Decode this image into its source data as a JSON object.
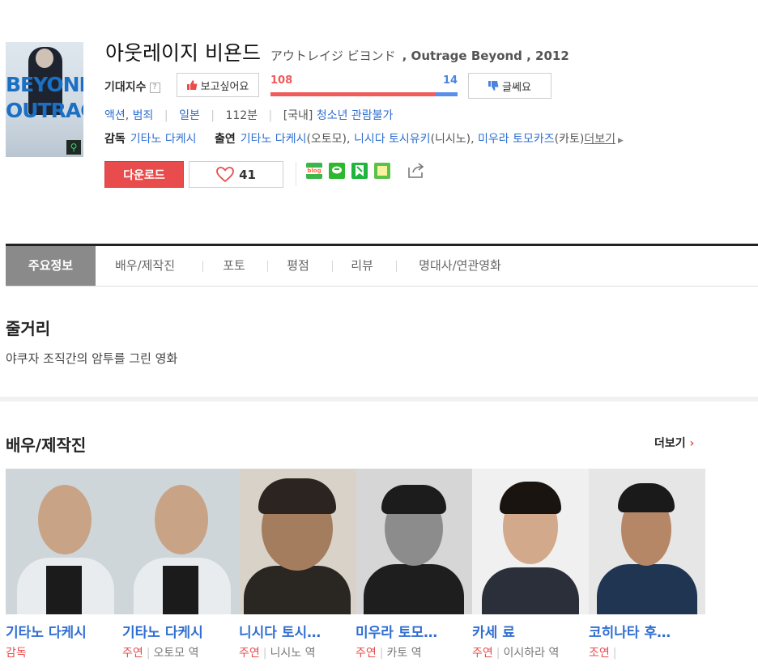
{
  "movie": {
    "title": "아웃레이지 비욘드",
    "title_jp": "アウトレイジ ビヨンド",
    "title_rest": ", Outrage Beyond , 2012",
    "poster_text_top": "BEYOND",
    "poster_text_bottom": "OUTRAGE"
  },
  "expectation": {
    "label": "기대지수",
    "help": "?",
    "want_label": "보고싶어요",
    "no_label": "글쎄요",
    "want_count": "108",
    "no_count": "14",
    "want_ratio": 0.885
  },
  "meta": {
    "genre1": "액션",
    "genre2": "범죄",
    "country": "일본",
    "runtime": "112분",
    "rating_prefix": "[국내]",
    "rating": "청소년 관람불가"
  },
  "credits": {
    "director_label": "감독",
    "director": "기타노 다케시",
    "cast_label": "출연",
    "actor1": "기타노 다케시",
    "role1": "(오토모)",
    "actor2": "니시다 토시유키",
    "role2": "(니시노)",
    "actor3": "미우라 토모카즈",
    "role3": "(카토)",
    "more": "더보기"
  },
  "actions": {
    "download": "다운로드",
    "likes": "41",
    "sns": [
      "blog",
      "talk",
      "bookmark",
      "memo"
    ]
  },
  "tabs": [
    "주요정보",
    "배우/제작진",
    "포토",
    "평점",
    "리뷰",
    "명대사/연관영화"
  ],
  "synopsis": {
    "heading": "줄거리",
    "text": "야쿠자 조직간의 암투를 그린 영화"
  },
  "cast_section": {
    "heading": "배우/제작진",
    "more": "더보기"
  },
  "cast": [
    {
      "name": "기타노 다케시",
      "role": "감독",
      "character": ""
    },
    {
      "name": "기타노 다케시",
      "role": "주연",
      "character": "오토모 역"
    },
    {
      "name": "니시다 토시…",
      "role": "주연",
      "character": "니시노 역"
    },
    {
      "name": "미우라 토모…",
      "role": "주연",
      "character": "카토 역"
    },
    {
      "name": "카세 료",
      "role": "주연",
      "character": "이시하라 역"
    },
    {
      "name": "코히나타 후…",
      "role": "조연",
      "character": ""
    }
  ],
  "colors": {
    "accent_red": "#e94c4c",
    "link_blue": "#2f6ed0",
    "bar_red": "#f05b5b",
    "bar_blue": "#5a8ee8"
  }
}
